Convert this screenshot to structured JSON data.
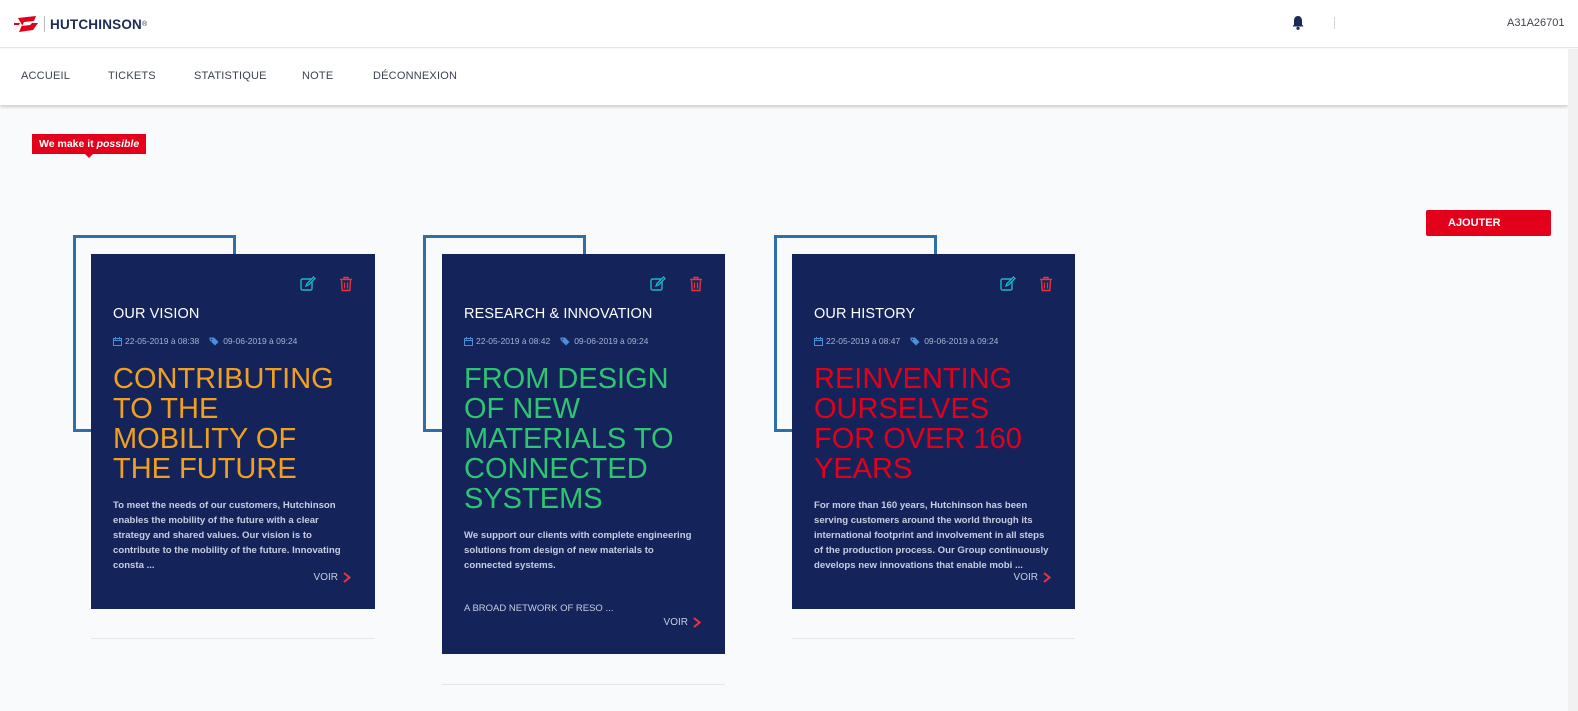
{
  "header": {
    "brand": "HUTCHINSON",
    "brand_mark": "®",
    "notification_icon": "bell-icon",
    "user_id": "A31A26701"
  },
  "nav": {
    "items": [
      {
        "label": "ACCUEIL"
      },
      {
        "label": "TICKETS"
      },
      {
        "label": "STATISTIQUE"
      },
      {
        "label": "NOTE"
      },
      {
        "label": "DÉCONNEXION"
      }
    ]
  },
  "tagline": {
    "prefix": "We make it ",
    "emphasis": "possible"
  },
  "add_button": "AJOUTER",
  "cards": [
    {
      "title": "OUR VISION",
      "created": "22-05-2019 à 08:38",
      "updated": "09-06-2019 à 09:24",
      "headline": "CONTRIBUTING TO THE MOBILITY OF THE FUTURE",
      "headline_color": "#f0a020",
      "description": "To meet the needs of our customers, Hutchinson enables the mobility of the future with a clear strategy and shared values. Our vision is to contribute to the mobility of the future. Innovating consta ...",
      "extra": "",
      "link": "VOIR"
    },
    {
      "title": "RESEARCH & INNOVATION",
      "created": "22-05-2019 à 08:42",
      "updated": "09-06-2019 à 09:24",
      "headline": "FROM DESIGN OF NEW MATERIALS TO CONNECTED SYSTEMS",
      "headline_color": "#2fc472",
      "description": "We support our clients with complete engineering solutions from design of new materials to connected systems.",
      "extra": "A BROAD NETWORK OF RESO ...",
      "link": "VOIR"
    },
    {
      "title": "OUR HISTORY",
      "created": "22-05-2019 à 08:47",
      "updated": "09-06-2019 à 09:24",
      "headline": "REINVENTING OURSELVES FOR OVER 160 YEARS",
      "headline_color": "#e2001a",
      "description": "For more than 160 years, Hutchinson has been serving customers around the world through its international footprint and involvement in all steps of the production process. Our Group continuously develops new innovations that enable mobi ...",
      "extra": "",
      "link": "VOIR"
    }
  ],
  "colors": {
    "accent_red": "#e2001a",
    "card_bg": "#14245a",
    "frame_blue": "#2e6faa",
    "edit_icon": "#1fb5c9",
    "delete_icon": "#e8343e"
  }
}
